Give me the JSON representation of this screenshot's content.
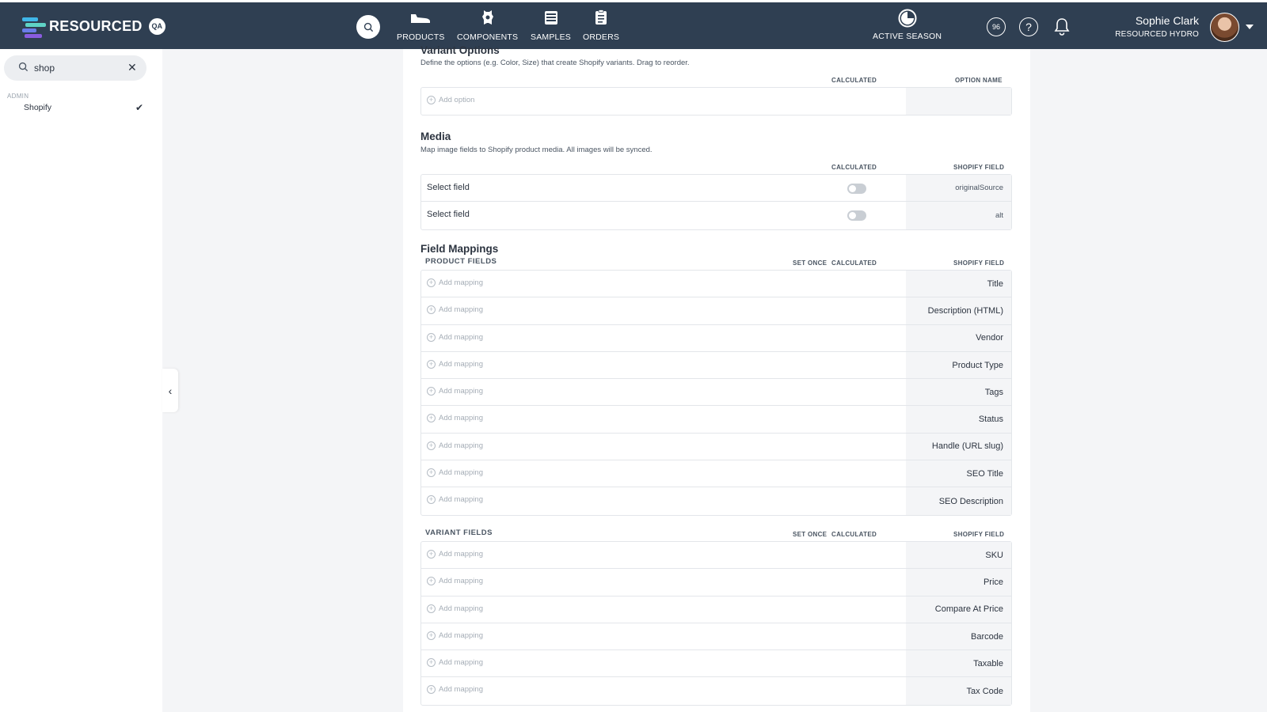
{
  "header": {
    "brand": "RESOURCED",
    "env_badge": "QA",
    "nav": [
      {
        "label": "PRODUCTS",
        "icon": "shoe-icon"
      },
      {
        "label": "COMPONENTS",
        "icon": "leather-hide-icon"
      },
      {
        "label": "SAMPLES",
        "icon": "samples-icon"
      },
      {
        "label": "ORDERS",
        "icon": "clipboard-icon"
      }
    ],
    "season_label": "ACTIVE SEASON",
    "counter_badge": "96",
    "help_icon": "question-circle-icon",
    "notifications_icon": "bell-icon",
    "user_name": "Sophie Clark",
    "user_org": "RESOURCED HYDRO"
  },
  "sidebar": {
    "search_value": "shop",
    "section_label": "ADMIN",
    "items": [
      {
        "label": "Shopify",
        "selected": true
      }
    ]
  },
  "variant_options": {
    "title": "Variant Options",
    "description": "Define the options (e.g. Color, Size) that create Shopify variants. Drag to reorder.",
    "col_calculated": "CALCULATED",
    "col_option_name": "OPTION NAME",
    "add_label": "Add option"
  },
  "media": {
    "title": "Media",
    "description": "Map image fields to Shopify product media. All images will be synced.",
    "col_calculated": "CALCULATED",
    "col_shopify_field": "SHOPIFY FIELD",
    "rows": [
      {
        "select_label": "Select field",
        "calculated": false,
        "shopify_field": "originalSource"
      },
      {
        "select_label": "Select field",
        "calculated": false,
        "shopify_field": "alt"
      }
    ]
  },
  "field_mappings": {
    "title": "Field Mappings",
    "add_label": "Add mapping",
    "product_fields": {
      "heading": "PRODUCT FIELDS",
      "col_set_once": "SET ONCE",
      "col_calculated": "CALCULATED",
      "col_shopify_field": "SHOPIFY FIELD",
      "rows": [
        "Title",
        "Description (HTML)",
        "Vendor",
        "Product Type",
        "Tags",
        "Status",
        "Handle (URL slug)",
        "SEO Title",
        "SEO Description"
      ]
    },
    "variant_fields": {
      "heading": "VARIANT FIELDS",
      "col_set_once": "SET ONCE",
      "col_calculated": "CALCULATED",
      "col_shopify_field": "SHOPIFY FIELD",
      "rows": [
        "SKU",
        "Price",
        "Compare At Price",
        "Barcode",
        "Taxable",
        "Tax Code"
      ]
    }
  },
  "colors": {
    "nav_bg": "#2f3f52",
    "page_bg": "#f4f5f7",
    "cell_bg": "#f4f5f7",
    "border": "#e3e6ea"
  }
}
